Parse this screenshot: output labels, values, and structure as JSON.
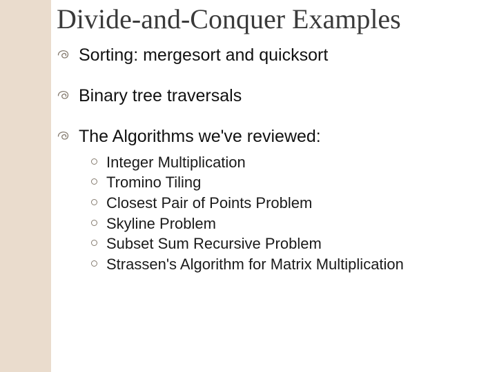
{
  "title": "Divide-and-Conquer Examples",
  "bullets": {
    "b0": "Sorting: mergesort and quicksort",
    "b1": "Binary tree traversals",
    "b2": "The Algorithms we've reviewed:"
  },
  "sub": {
    "s0": "Integer Multiplication",
    "s1": "Tromino Tiling",
    "s2": "Closest Pair of Points Problem",
    "s3": "Skyline Problem",
    "s4": "Subset Sum Recursive Problem",
    "s5": "Strassen's Algorithm for Matrix Multiplication"
  },
  "colors": {
    "accent": "#eadccd",
    "swirl": "#857b6f"
  }
}
